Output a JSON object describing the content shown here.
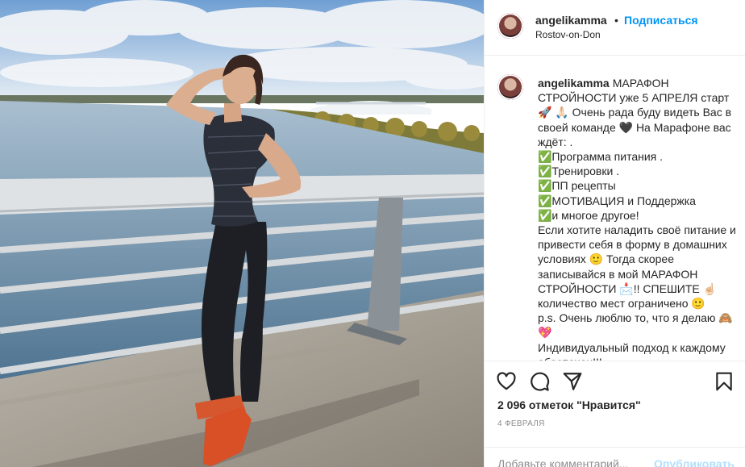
{
  "post": {
    "username": "angelikamma",
    "dot": "•",
    "follow_label": "Подписаться",
    "location": "Rostov-on-Don"
  },
  "caption": {
    "username": "angelikamma",
    "text": "МАРАФОН СТРОЙНОСТИ уже 5 АПРЕЛЯ старт🚀 🙏🏻 Очень рада буду видеть Вас в своей команде 🖤 На Марафоне вас ждёт: .\n✅Программа питания .\n✅Тренировки .\n✅ПП рецепты\n✅МОТИВАЦИЯ и Поддержка\n✅и многое другое!\nЕсли хотите наладить своё питание и привести себя в форму в домашних условиях 🙂 Тогда скорее записывайся в мой МАРАФОН СТРОЙНОСТИ 📩!! СПЕШИТЕ ☝🏻 количество мест ограничено 🙂\np.s. Очень люблю то, что я делаю 🙈💖\nИндивидуальный подход к каждому обеспечен!!!"
  },
  "icons": {
    "like": "heart-icon",
    "comment": "comment-icon",
    "share": "paper-plane-icon",
    "save": "bookmark-icon"
  },
  "stats": {
    "likes_text": "2 096 отметок \"Нравится\"",
    "date": "4 ФЕВРАЛЯ"
  },
  "comment": {
    "placeholder": "Добавьте комментарий...",
    "publish_label": "Опубликовать"
  },
  "colors": {
    "accent": "#0095f6",
    "publish_disabled": "#b2dffc",
    "muted": "#8e8e8e",
    "border": "#efefef"
  }
}
